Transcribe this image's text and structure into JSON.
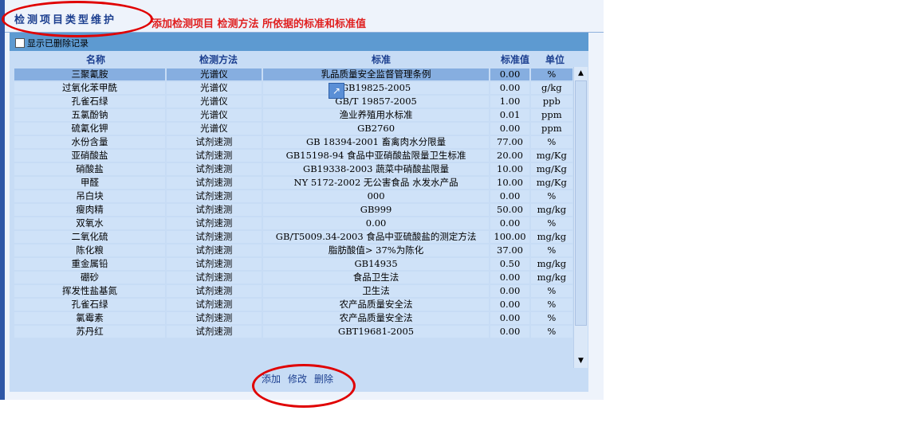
{
  "header": {
    "tab_title": "检测项目类型维护",
    "annotation": "添加检测项目  检测方法 所依据的标准和标准值"
  },
  "toolbar": {
    "show_deleted_label": "显示已删除记录"
  },
  "columns": [
    "名称",
    "检测方法",
    "标准",
    "标准值",
    "单位"
  ],
  "rows": [
    [
      "三聚氰胺",
      "光谱仪",
      "乳品质量安全监督管理条例",
      "0.00",
      "%"
    ],
    [
      "过氧化苯甲酰",
      "光谱仪",
      "GB19825-2005",
      "0.00",
      "g/kg"
    ],
    [
      "孔雀石绿",
      "光谱仪",
      "GB/T 19857-2005",
      "1.00",
      "ppb"
    ],
    [
      "五氯酚钠",
      "光谱仪",
      "渔业养殖用水标准",
      "0.01",
      "ppm"
    ],
    [
      "硫氰化钾",
      "光谱仪",
      "GB2760",
      "0.00",
      "ppm"
    ],
    [
      "水份含量",
      "试剂速测",
      "GB 18394-2001 畜禽肉水分限量",
      "77.00",
      "%"
    ],
    [
      "亚硝酸盐",
      "试剂速测",
      "GB15198-94 食品中亚硝酸盐限量卫生标准",
      "20.00",
      "mg/Kg"
    ],
    [
      "硝酸盐",
      "试剂速测",
      "GB19338-2003 蔬菜中硝酸盐限量",
      "10.00",
      "mg/Kg"
    ],
    [
      "甲醛",
      "试剂速测",
      "NY 5172-2002 无公害食品 水发水产品",
      "10.00",
      "mg/Kg"
    ],
    [
      "吊白块",
      "试剂速测",
      "000",
      "0.00",
      "%"
    ],
    [
      "瘦肉精",
      "试剂速测",
      "GB999",
      "50.00",
      "mg/kg"
    ],
    [
      "双氧水",
      "试剂速测",
      "0.00",
      "0.00",
      "%"
    ],
    [
      "二氧化硫",
      "试剂速测",
      "GB/T5009.34-2003 食品中亚硫酸盐的测定方法",
      "100.00",
      "mg/kg"
    ],
    [
      "陈化粮",
      "试剂速测",
      "脂肪酸值> 37%为陈化",
      "37.00",
      "%"
    ],
    [
      "重金属铅",
      "试剂速测",
      "GB14935",
      "0.50",
      "mg/kg"
    ],
    [
      "硼砂",
      "试剂速测",
      "食品卫生法",
      "0.00",
      "mg/kg"
    ],
    [
      "挥发性盐基氮",
      "试剂速测",
      "卫生法",
      "0.00",
      "%"
    ],
    [
      "孔雀石绿",
      "试剂速测",
      "农产品质量安全法",
      "0.00",
      "%"
    ],
    [
      "氯霉素",
      "试剂速测",
      "农产品质量安全法",
      "0.00",
      "%"
    ],
    [
      "苏丹红",
      "试剂速测",
      "GBT19681-2005",
      "0.00",
      "%"
    ]
  ],
  "selected_row": 0,
  "actions": {
    "add": "添加",
    "edit": "修改",
    "delete": "删除"
  },
  "icons": {
    "scroll_up": "▲",
    "scroll_down": "▼",
    "cursor": "↗"
  }
}
